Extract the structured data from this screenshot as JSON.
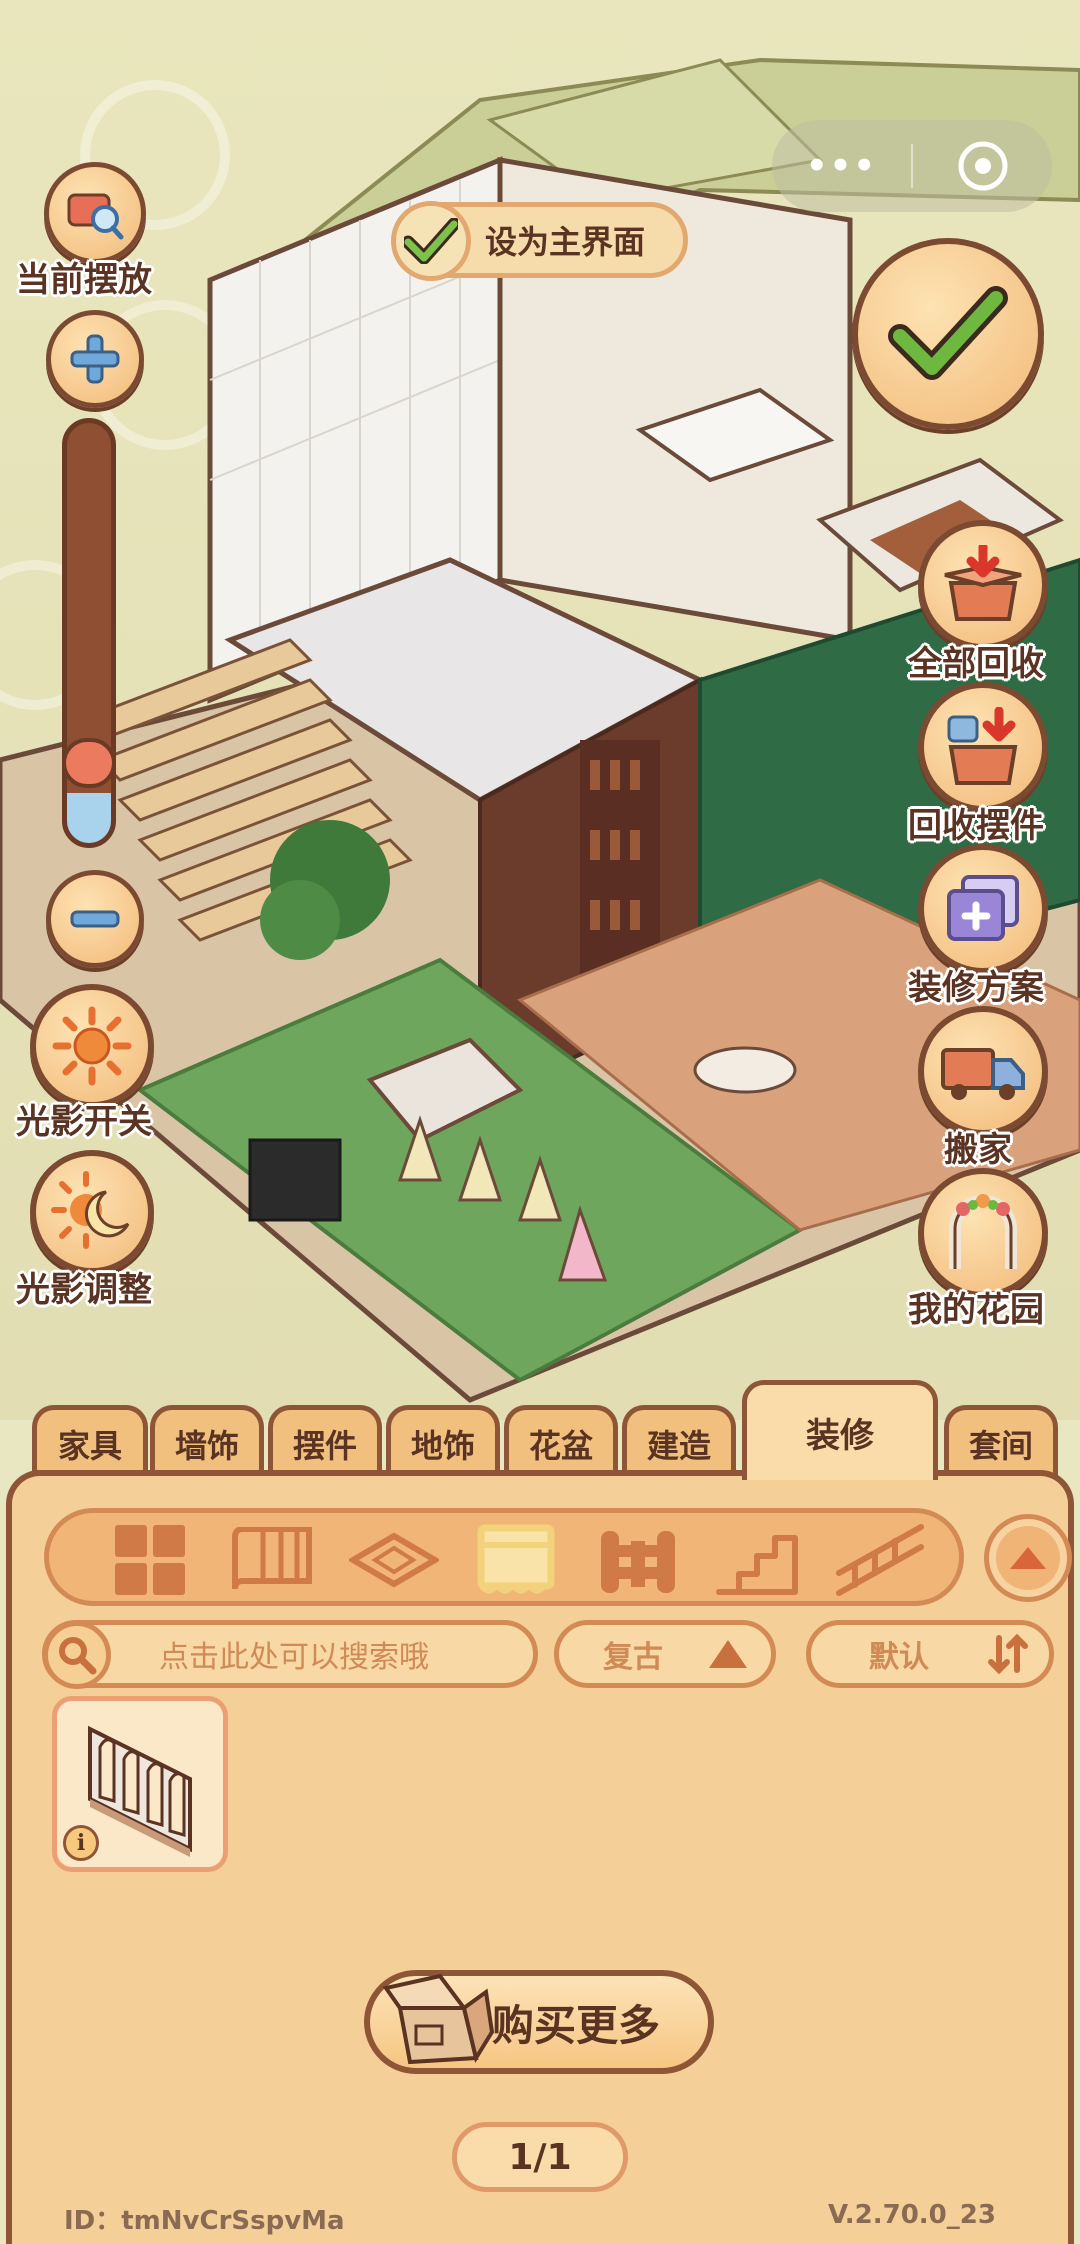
{
  "top": {
    "set_main_label": "设为主界面",
    "menu_dots": "•••"
  },
  "left_controls": {
    "current_label": "当前摆放",
    "light_toggle_label": "光影开关",
    "light_adjust_label": "光影调整",
    "zoom_level": 0.12
  },
  "right_controls": {
    "recall_all_label": "全部回收",
    "recall_ornaments_label": "回收摆件",
    "decor_plan_label": "装修方案",
    "move_label": "搬家",
    "garden_label": "我的花园"
  },
  "tabs": [
    {
      "label": "家具"
    },
    {
      "label": "墙饰"
    },
    {
      "label": "摆件"
    },
    {
      "label": "地饰"
    },
    {
      "label": "花盆"
    },
    {
      "label": "建造"
    },
    {
      "label": "装修",
      "active": true
    },
    {
      "label": "套间"
    }
  ],
  "categories": [
    "all-grid-icon",
    "wall-panel-icon",
    "floor-tile-icon",
    "window-frame-icon",
    "fence-icon",
    "stairs-icon",
    "railing-icon"
  ],
  "search": {
    "placeholder": "点击此处可以搜索哦"
  },
  "filter": {
    "label": "复古"
  },
  "sort": {
    "label": "默认"
  },
  "buy_more_label": "购买更多",
  "pagination": "1/1",
  "footer": {
    "id_text": "ID：tmNvCrSspvMa",
    "version": "V.2.70.0_23"
  },
  "colors": {
    "panel": "#f5cf98",
    "border": "#8e5636",
    "accent_green": "#5b9a3b",
    "text_brown": "#5a3322"
  }
}
